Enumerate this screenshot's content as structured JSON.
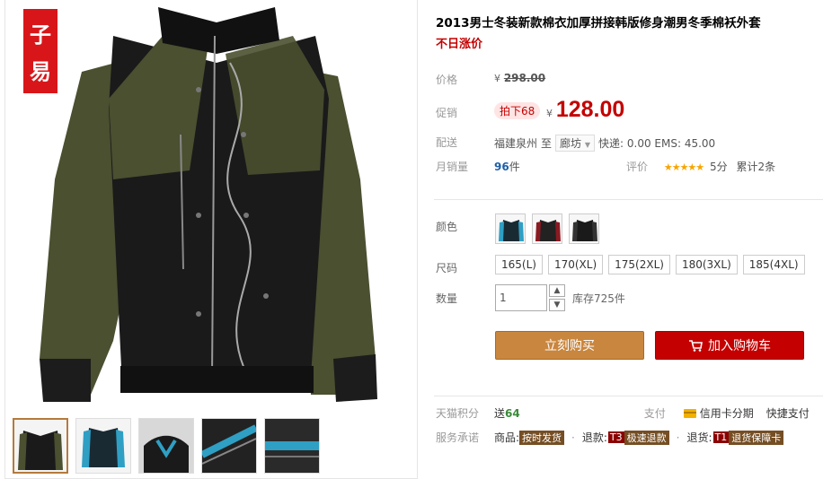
{
  "brand_badge": [
    "子",
    "易"
  ],
  "product": {
    "title": "2013男士冬装新款棉衣加厚拼接韩版修身潮男冬季棉袄外套",
    "subtitle": "不日涨价"
  },
  "price": {
    "label": "价格",
    "currency": "¥",
    "original": "298.00"
  },
  "promo": {
    "label": "促销",
    "tag": "拍下68",
    "currency": "¥",
    "price": "128.00"
  },
  "shipping": {
    "label": "配送",
    "from": "福建泉州",
    "to_word": "至",
    "city": "廊坊",
    "rates": "快递: 0.00 EMS: 45.00"
  },
  "sales": {
    "label": "月销量",
    "count": "96",
    "unit": "件"
  },
  "rating": {
    "label": "评价",
    "stars": "★★★★★",
    "score": "5分",
    "reviews": "累计2条"
  },
  "options": {
    "color_label": "颜色",
    "size_label": "尺码",
    "sizes": [
      "165(L)",
      "170(XL)",
      "175(2XL)",
      "180(3XL)",
      "185(4XL)"
    ],
    "qty_label": "数量",
    "qty_value": "1",
    "stock": "库存725件"
  },
  "actions": {
    "buy": "立刻购买",
    "cart": "加入购物车"
  },
  "points": {
    "label": "天猫积分",
    "send": "送",
    "value": "64",
    "pay_label": "支付",
    "credit": "信用卡分期",
    "express_pay": "快捷支付"
  },
  "service": {
    "label": "服务承诺",
    "goods": "商品:",
    "goods_tag": "按时发货",
    "refund": "退款:",
    "refund_tag_code": "T3",
    "refund_tag": "极速退款",
    "return": "退货:",
    "return_tag_code": "T1",
    "return_tag": "退货保障卡"
  },
  "colors": {
    "red": "#c40000",
    "orange": "#c9863e",
    "olive": "#4a5030"
  }
}
